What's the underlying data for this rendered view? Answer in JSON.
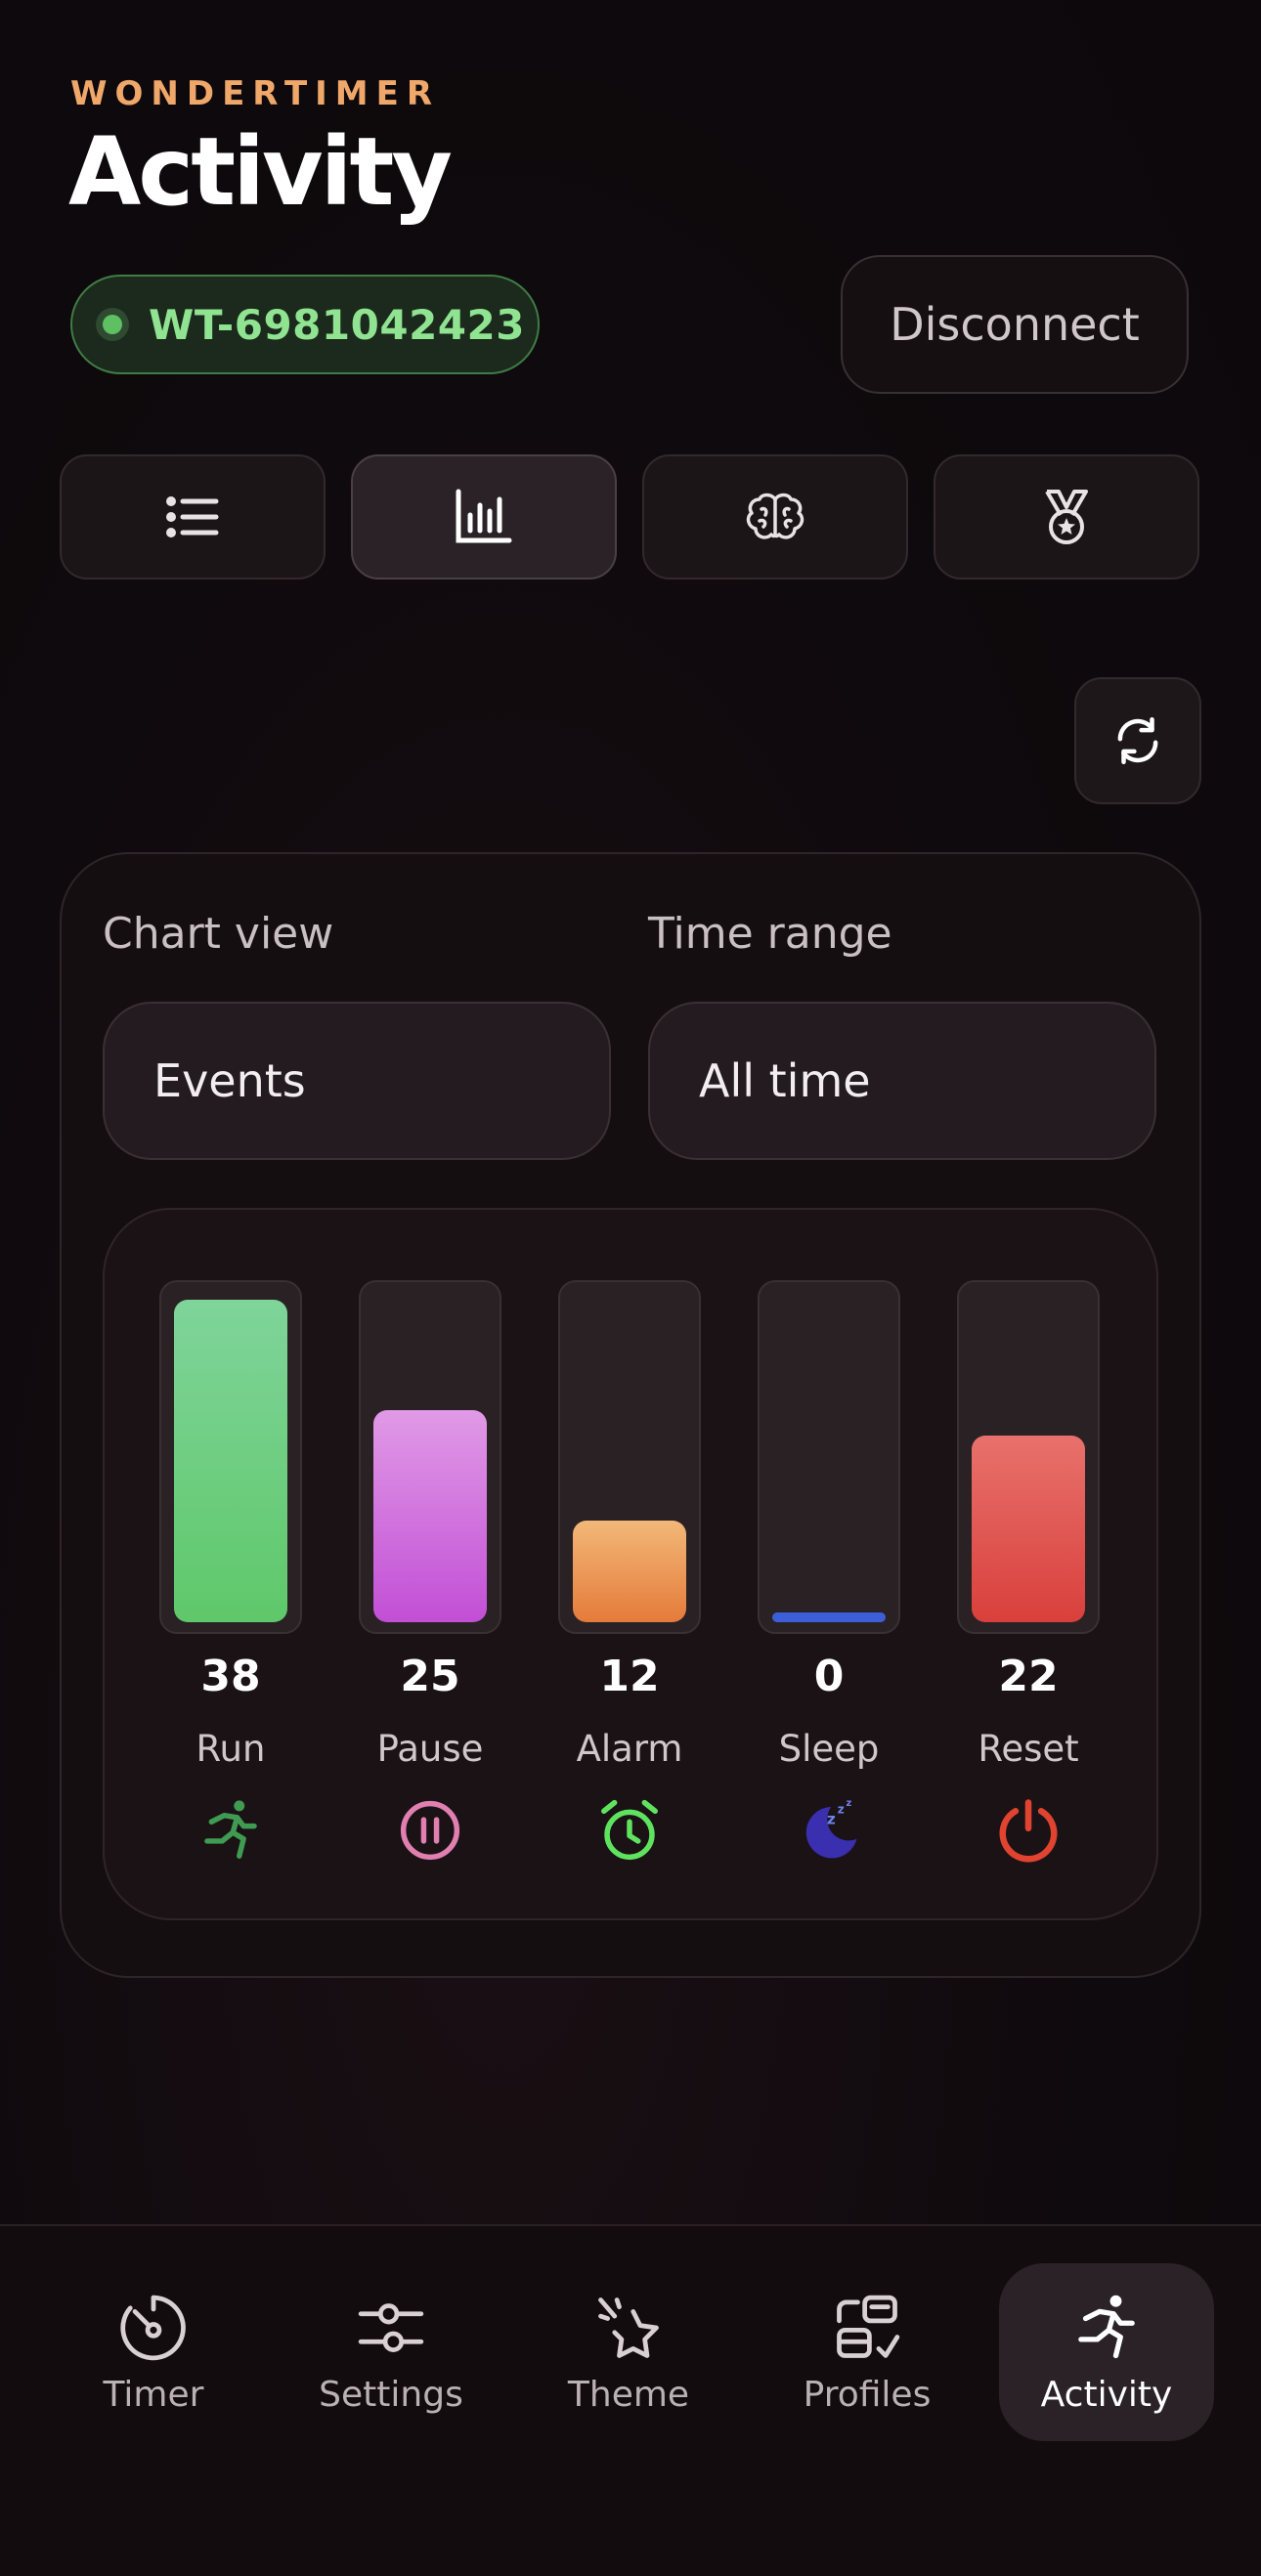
{
  "header": {
    "brand": "WONDERTIMER",
    "title": "Activity"
  },
  "device": {
    "id": "WT-6981042423",
    "status_color": "#5fbf63"
  },
  "disconnect_label": "Disconnect",
  "tabs": [
    {
      "icon": "list-icon",
      "active": false
    },
    {
      "icon": "bar-chart-icon",
      "active": true
    },
    {
      "icon": "brain-icon",
      "active": false
    },
    {
      "icon": "medal-icon",
      "active": false
    }
  ],
  "refresh_icon": "refresh-icon",
  "filters": {
    "chart_view_label": "Chart view",
    "chart_view_value": "Events",
    "time_range_label": "Time range",
    "time_range_value": "All time"
  },
  "chart_data": {
    "type": "bar",
    "categories": [
      "Run",
      "Pause",
      "Alarm",
      "Sleep",
      "Reset"
    ],
    "values": [
      38,
      25,
      12,
      0,
      22
    ],
    "ylim": [
      0,
      38
    ],
    "colors": [
      "#5fc86a",
      "#c24fd6",
      "#e57b3a",
      "#3c5fd8",
      "#d9403c"
    ],
    "icons": [
      "run-icon",
      "pause-icon",
      "alarm-icon",
      "sleep-icon",
      "power-icon"
    ]
  },
  "nav": {
    "items": [
      {
        "label": "Timer",
        "icon": "timer-icon",
        "active": false
      },
      {
        "label": "Settings",
        "icon": "sliders-icon",
        "active": false
      },
      {
        "label": "Theme",
        "icon": "theme-icon",
        "active": false
      },
      {
        "label": "Profiles",
        "icon": "profiles-icon",
        "active": false
      },
      {
        "label": "Activity",
        "icon": "run-icon",
        "active": true
      }
    ]
  }
}
